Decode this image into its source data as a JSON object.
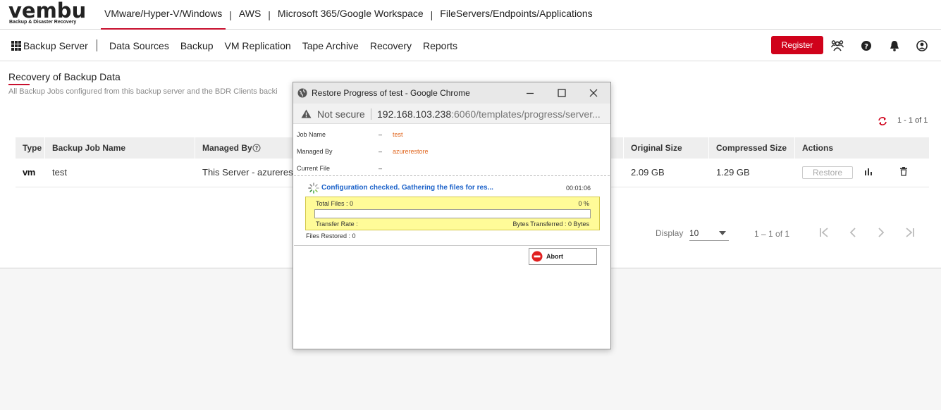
{
  "brand": {
    "word_left": "vemb",
    "word_right": "u",
    "tagline": "Backup & Disaster Recovery"
  },
  "product_tabs": [
    "VMware/Hyper-V/Windows",
    "AWS",
    "Microsoft 365/Google Workspace",
    "FileServers/Endpoints/Applications"
  ],
  "product_tab_separator": "|",
  "nav": {
    "brand": "Backup Server",
    "items": [
      "Data Sources",
      "Backup",
      "VM Replication",
      "Tape Archive",
      "Recovery",
      "Reports"
    ],
    "register": "Register",
    "icons": [
      "users-icon",
      "help-icon",
      "bell-icon",
      "user-icon"
    ]
  },
  "page": {
    "title": "Recovery of Backup Data",
    "subtitle": "All Backup Jobs configured from this backup server and the BDR Clients backi",
    "range_top": "1 - 1 of 1"
  },
  "table": {
    "columns": [
      "Type",
      "Backup Job Name",
      "Managed By",
      "Original Size",
      "Compressed Size",
      "Actions"
    ],
    "rows": [
      {
        "type": "vm",
        "job_name": "test",
        "managed_by": "This Server - azurerest",
        "original_size": "2.09 GB",
        "compressed_size": "1.29 GB",
        "restore_label": "Restore"
      }
    ]
  },
  "pagination": {
    "display_label": "Display",
    "display_value": "10",
    "range": "1 – 1 of 1"
  },
  "popup": {
    "title": "Restore Progress of test - Google Chrome",
    "not_secure": "Not secure",
    "url_host": "192.168.103.238",
    "url_rest": ":6060/templates/progress/server...",
    "fields": [
      {
        "label": "Job Name",
        "sep": "–",
        "value": "test"
      },
      {
        "label": "Managed By",
        "sep": "–",
        "value": "azurerestore"
      },
      {
        "label": "Current File",
        "sep": "–",
        "value": ""
      }
    ],
    "status": "Configuration checked. Gathering the files for res...",
    "elapsed": "00:01:06",
    "total_files": "Total Files : 0",
    "percent": "0 %",
    "progress": 0,
    "transfer_rate": "Transfer Rate :",
    "bytes_transferred": "Bytes Transferred :  0 Bytes",
    "files_restored": "Files Restored : 0",
    "abort": "Abort"
  },
  "colors": {
    "accent": "#c8102e",
    "register": "#d0021b",
    "status_blue": "#1c62c9",
    "value_orange": "#e0651d",
    "progress_box": "#fffb98"
  }
}
